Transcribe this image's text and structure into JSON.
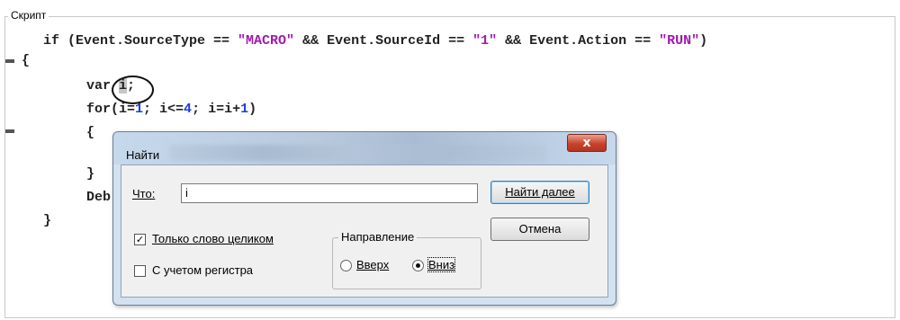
{
  "groupbox": {
    "title": "Скрипт"
  },
  "code": {
    "line1": {
      "if": "if (Event.SourceType == ",
      "s1": "\"MACRO\"",
      "and1": " && Event.SourceId == ",
      "s2": "\"1\"",
      "and2": " && Event.Action == ",
      "s3": "\"RUN\"",
      "end": ")"
    },
    "line2": "{",
    "line3": {
      "pre": "var ",
      "sel": "i",
      "post": ";"
    },
    "line4": {
      "a": "for(i=",
      "n1": "1",
      "b": "; i<=",
      "n2": "4",
      "c": "; i=i+",
      "n3": "1",
      "d": ")"
    },
    "line5": "{",
    "line6": "}",
    "line7": "Deb",
    "line8": "}"
  },
  "dialog": {
    "title": "Найти",
    "close_label": "x",
    "find_what_label": "Что:",
    "find_input_value": "i",
    "find_next_button": "Найти далее",
    "cancel_button": "Отмена",
    "whole_word_label": "Только слово целиком",
    "whole_word_checked": true,
    "match_case_label": "С учетом регистра",
    "match_case_checked": false,
    "direction": {
      "legend": "Направление",
      "up_label": "Вверх",
      "down_label": "Вниз",
      "selected": "down"
    }
  }
}
